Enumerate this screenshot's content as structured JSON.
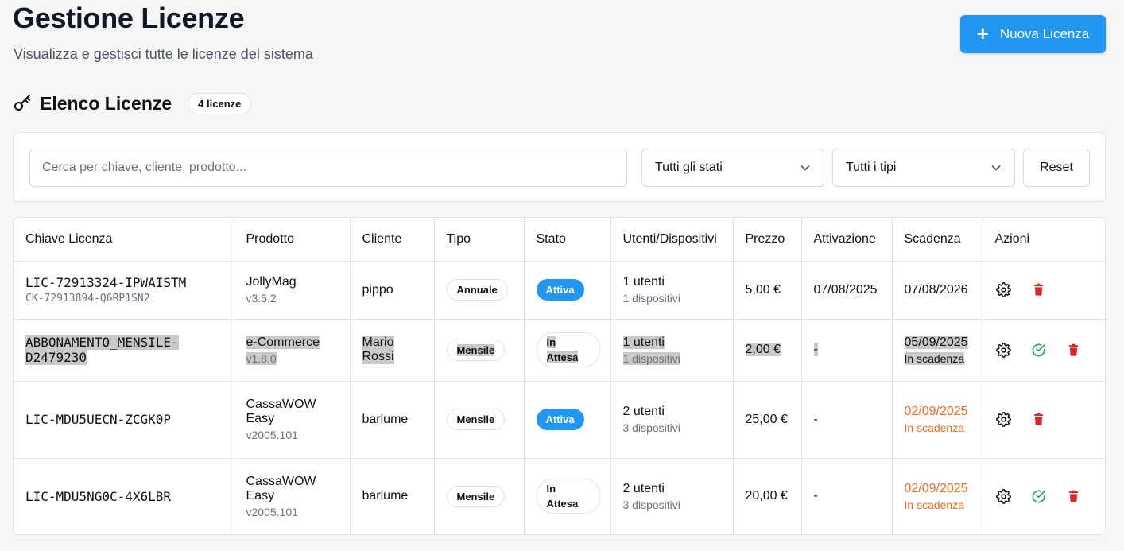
{
  "header": {
    "title": "Gestione Licenze",
    "subtitle": "Visualizza e gestisci tutte le licenze del sistema",
    "new_button": "Nuova Licenza"
  },
  "section": {
    "title": "Elenco Licenze",
    "count": "4 licenze",
    "icon": "key-icon"
  },
  "filters": {
    "search_placeholder": "Cerca per chiave, cliente, prodotto...",
    "status_select": "Tutti gli stati",
    "type_select": "Tutti i tipi",
    "reset": "Reset"
  },
  "table": {
    "columns": [
      "Chiave Licenza",
      "Prodotto",
      "Cliente",
      "Tipo",
      "Stato",
      "Utenti/Dispositivi",
      "Prezzo",
      "Attivazione",
      "Scadenza",
      "Azioni"
    ],
    "rows": [
      {
        "key": "LIC-72913324-IPWAISTM",
        "key_sub": "CK-72913894-Q6RP1SN2",
        "product": "JollyMag",
        "version": "v3.5.2",
        "client": "pippo",
        "type": "Annuale",
        "status": "Attiva",
        "users": "1 utenti",
        "devices": "1 dispositivi",
        "price": "5,00 €",
        "activation": "07/08/2025",
        "expiry": "07/08/2026",
        "expiry_note": ""
      },
      {
        "key": "ABBONAMENTO_MENSILE-D2479230",
        "key_line1": "ABBONAMENTO_MENSILE-",
        "key_line2": "D2479230",
        "product": "e-Commerce",
        "version": "v1.8.0",
        "client": "Mario Rossi",
        "client_line1": "Mario",
        "client_line2": "Rossi",
        "type": "Mensile",
        "status": "In Attesa",
        "status_line1": "In",
        "status_line2": "Attesa",
        "users": "1 utenti",
        "devices": "1 dispositivi",
        "price": "2,00 €",
        "activation": "-",
        "expiry": "05/09/2025",
        "expiry_note": "In scadenza"
      },
      {
        "key": "LIC-MDU5UECN-ZCGK0P",
        "product": "CassaWOW Easy",
        "product_line1": "CassaWOW",
        "product_line2": "Easy",
        "version": "v2005.101",
        "client": "barlume",
        "type": "Mensile",
        "status": "Attiva",
        "users": "2 utenti",
        "devices": "3 dispositivi",
        "price": "25,00 €",
        "activation": "-",
        "expiry": "02/09/2025",
        "expiry_note": "In scadenza"
      },
      {
        "key": "LIC-MDU5NG0C-4X6LBR",
        "product": "CassaWOW Easy",
        "product_line1": "CassaWOW",
        "product_line2": "Easy",
        "version": "v2005.101",
        "client": "barlume",
        "type": "Mensile",
        "status": "In Attesa",
        "status_line1": "In",
        "status_line2": "Attesa",
        "users": "2 utenti",
        "devices": "3 dispositivi",
        "price": "20,00 €",
        "activation": "-",
        "expiry": "02/09/2025",
        "expiry_note": "In scadenza"
      }
    ]
  },
  "colors": {
    "primary": "#2196f3",
    "warning": "#f26b1d",
    "danger": "#dc2626",
    "success": "#16a34a"
  }
}
